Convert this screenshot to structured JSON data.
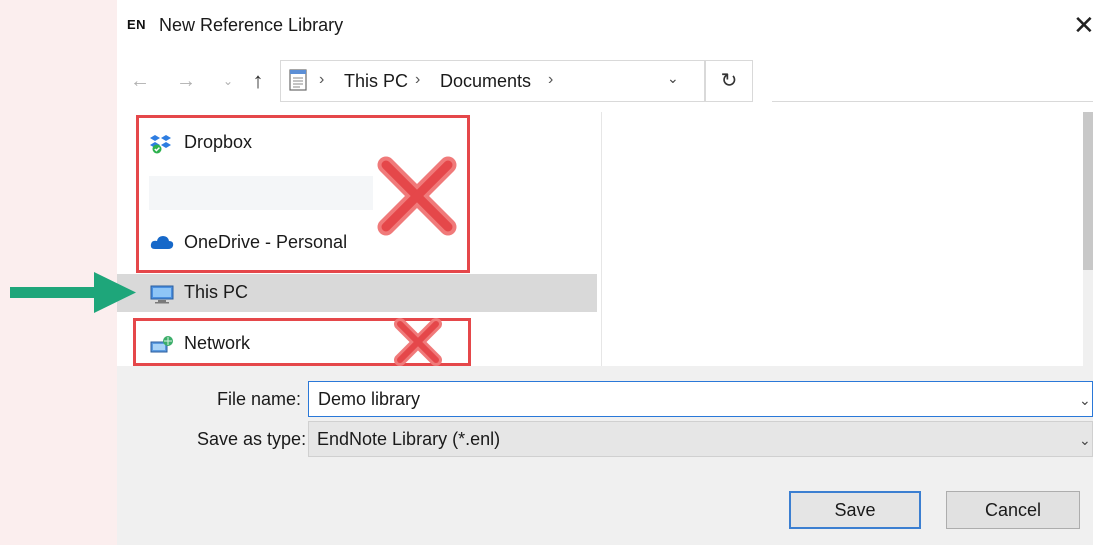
{
  "window": {
    "app_badge": "EN",
    "title": "New Reference Library",
    "close_glyph": "✕"
  },
  "nav": {
    "back_glyph": "←",
    "forward_glyph": "→",
    "recent_glyph": "⌄",
    "up_glyph": "↑",
    "refresh_glyph": "↻",
    "address": {
      "separator": "›",
      "crumbs": [
        "This PC",
        "Documents"
      ],
      "dropdown_glyph": "⌄"
    }
  },
  "sidebar": {
    "items": [
      {
        "label": "Dropbox",
        "icon": "dropbox-icon"
      },
      {
        "label": "OneDrive - Personal",
        "icon": "onedrive-icon"
      },
      {
        "label": "This PC",
        "icon": "monitor-icon",
        "selected": true
      },
      {
        "label": "Network",
        "icon": "network-icon"
      }
    ]
  },
  "form": {
    "file_name_label": "File name:",
    "file_name_value": "Demo library",
    "save_type_label": "Save as type:",
    "save_type_value": "EndNote Library (*.enl)",
    "dropdown_glyph": "⌄"
  },
  "buttons": {
    "save": "Save",
    "cancel": "Cancel"
  },
  "colors": {
    "annotation_red": "#e5474a",
    "annotation_x": "#f07a7a",
    "arrow_green": "#1ea67a",
    "selection": "#d9d9d9",
    "focus_blue": "#2a78d8"
  }
}
